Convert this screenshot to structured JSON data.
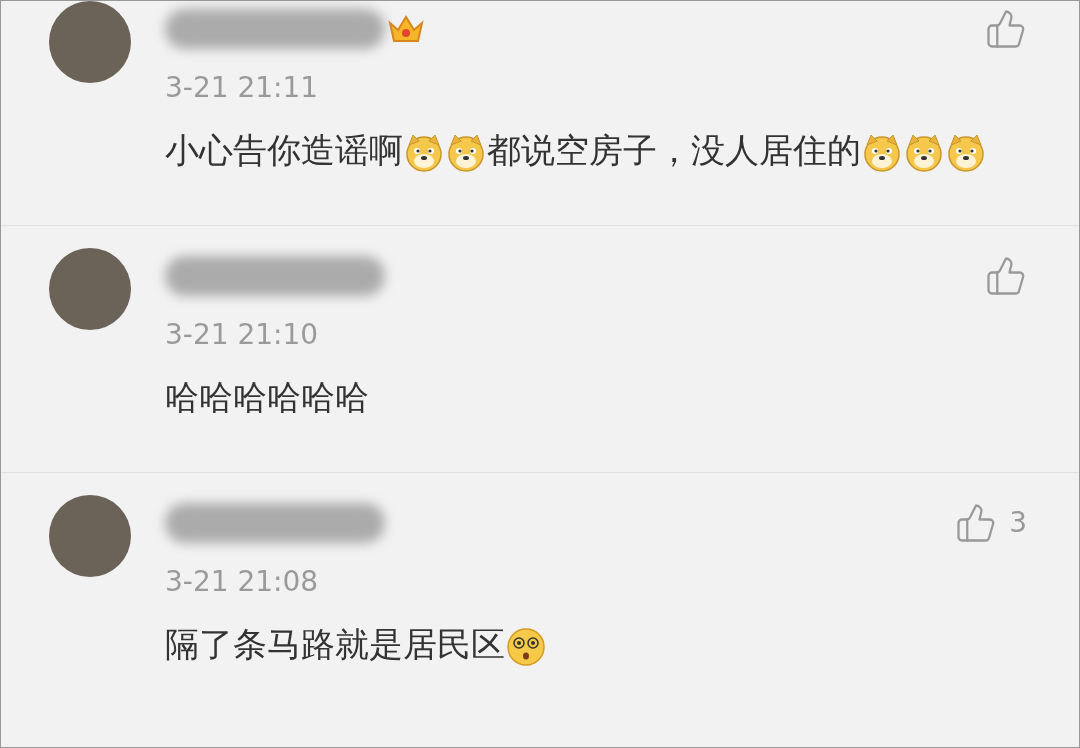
{
  "comments": [
    {
      "badge": true,
      "time": "3-21 21:11",
      "parts": [
        {
          "kind": "text",
          "text": "小心告你造谣啊"
        },
        {
          "kind": "doge"
        },
        {
          "kind": "doge"
        },
        {
          "kind": "text",
          "text": "都说空房子，没人居住的"
        },
        {
          "kind": "doge"
        },
        {
          "kind": "doge"
        },
        {
          "kind": "doge"
        }
      ]
    },
    {
      "badge": false,
      "time": "3-21 21:10",
      "parts": [
        {
          "kind": "text",
          "text": "哈哈哈哈哈哈"
        }
      ]
    },
    {
      "badge": false,
      "time": "3-21 21:08",
      "likes": "3",
      "parts": [
        {
          "kind": "text",
          "text": "隔了条马路就是居民区"
        },
        {
          "kind": "dizzy"
        }
      ]
    }
  ]
}
